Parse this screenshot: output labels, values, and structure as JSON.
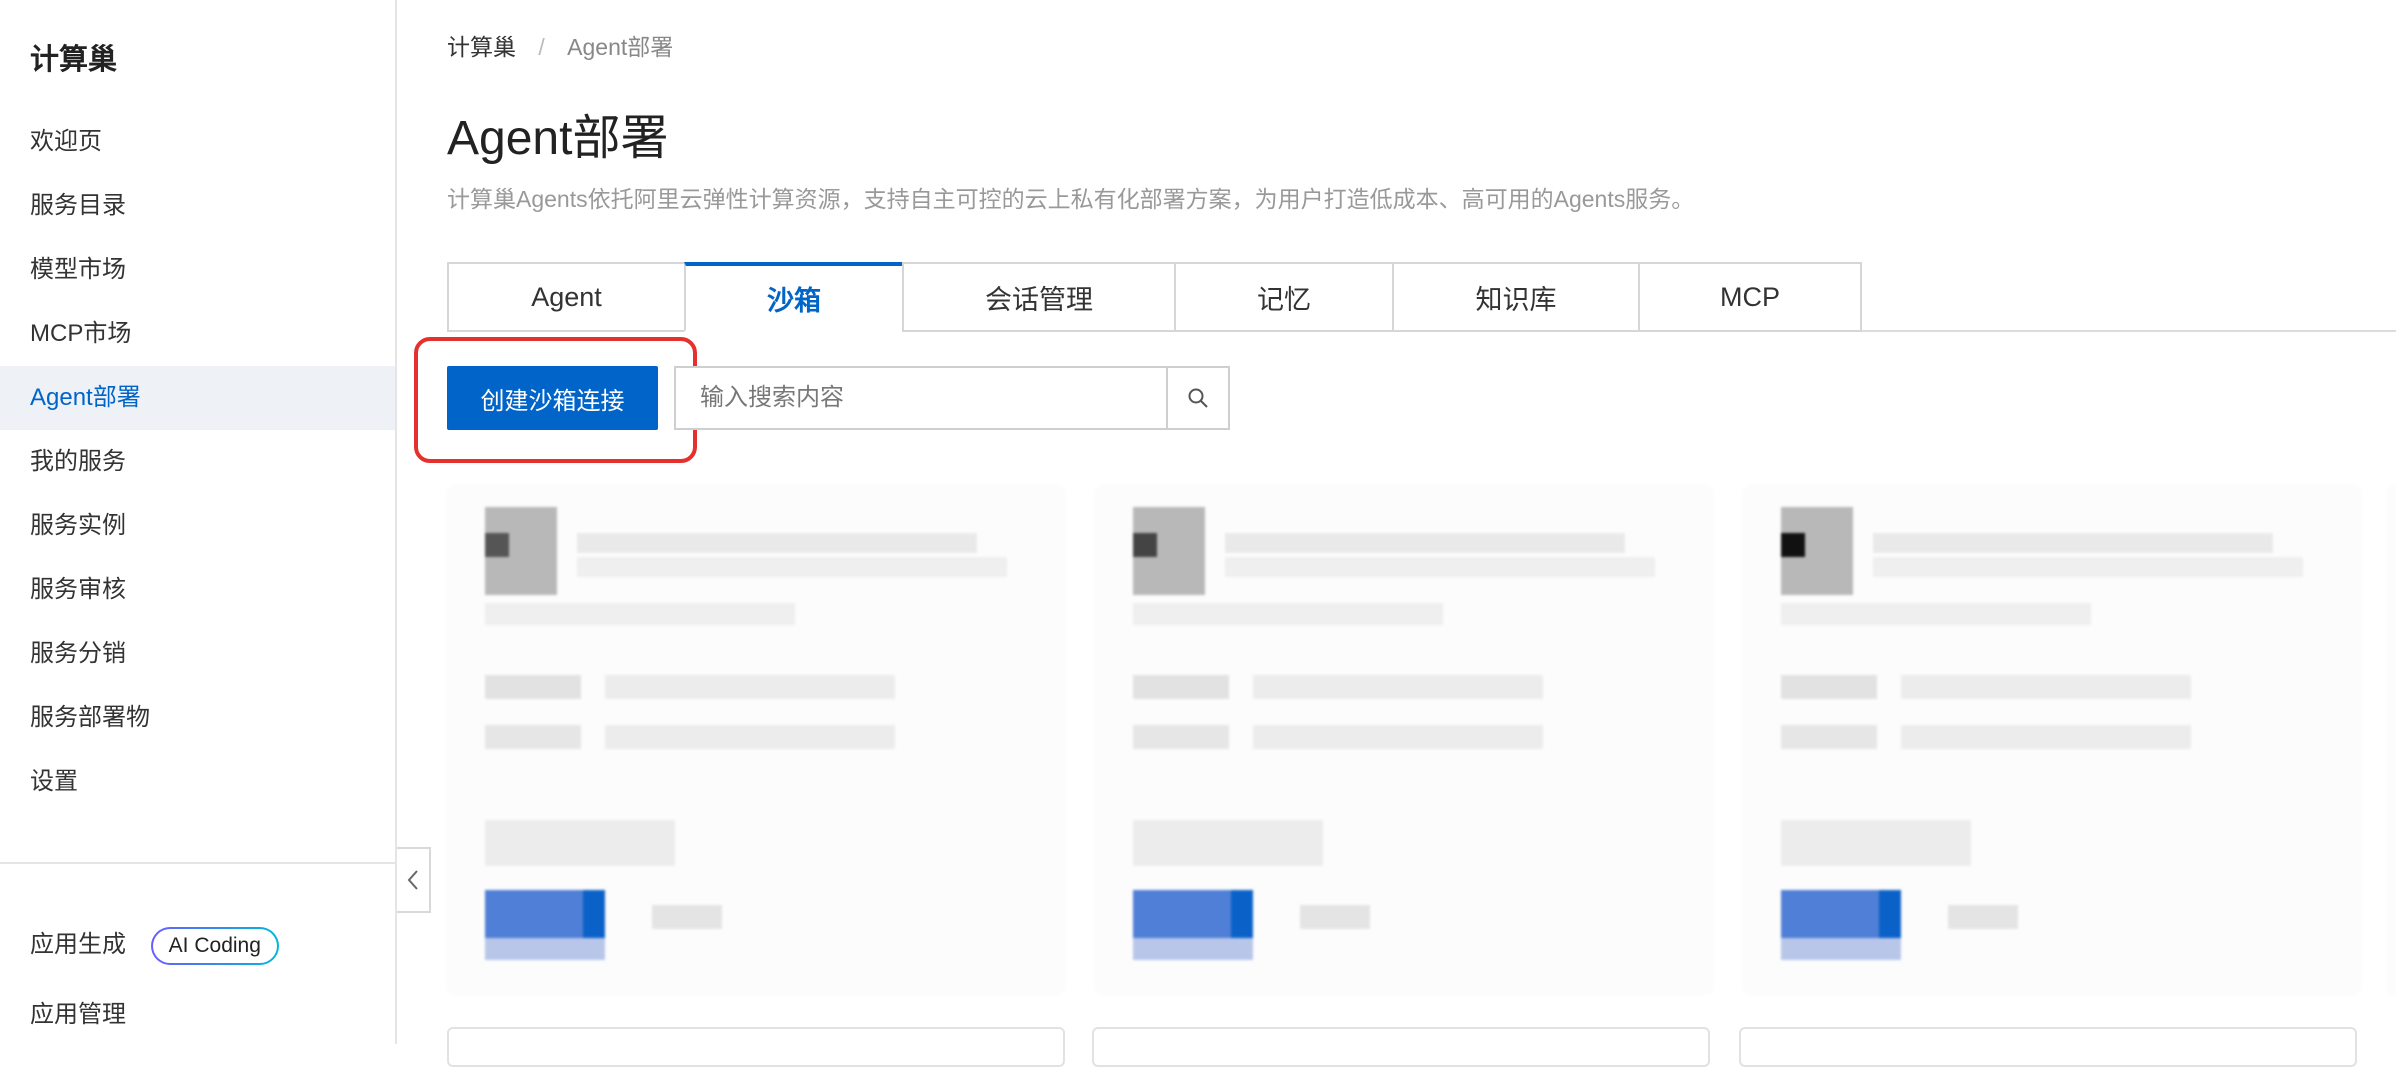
{
  "sidebar": {
    "brand": "计算巢",
    "items": [
      {
        "label": "欢迎页",
        "active": false
      },
      {
        "label": "服务目录",
        "active": false
      },
      {
        "label": "模型市场",
        "active": false
      },
      {
        "label": "MCP市场",
        "active": false
      },
      {
        "label": "Agent部署",
        "active": true
      },
      {
        "label": "我的服务",
        "active": false
      },
      {
        "label": "服务实例",
        "active": false
      },
      {
        "label": "服务审核",
        "active": false
      },
      {
        "label": "服务分销",
        "active": false
      },
      {
        "label": "服务部署物",
        "active": false
      },
      {
        "label": "设置",
        "active": false
      }
    ],
    "bottom": {
      "app_gen_label": "应用生成",
      "ai_badge": "AI Coding",
      "app_manage_label": "应用管理"
    },
    "collapse_icon": "chevron-left-icon"
  },
  "breadcrumb": {
    "root": "计算巢",
    "separator": "/",
    "current": "Agent部署"
  },
  "page": {
    "title": "Agent部署",
    "description": "计算巢Agents依托阿里云弹性计算资源，支持自主可控的云上私有化部署方案，为用户打造低成本、高可用的Agents服务。"
  },
  "tabs": [
    {
      "label": "Agent",
      "active": false
    },
    {
      "label": "沙箱",
      "active": true
    },
    {
      "label": "会话管理",
      "active": false
    },
    {
      "label": "记忆",
      "active": false
    },
    {
      "label": "知识库",
      "active": false
    },
    {
      "label": "MCP",
      "active": false
    }
  ],
  "toolbar": {
    "create_label": "创建沙箱连接",
    "search_placeholder": "输入搜索内容",
    "search_icon": "search-icon"
  },
  "colors": {
    "accent": "#0064c8",
    "highlight": "#e5312e",
    "active_nav_bg": "#eef1f6"
  }
}
